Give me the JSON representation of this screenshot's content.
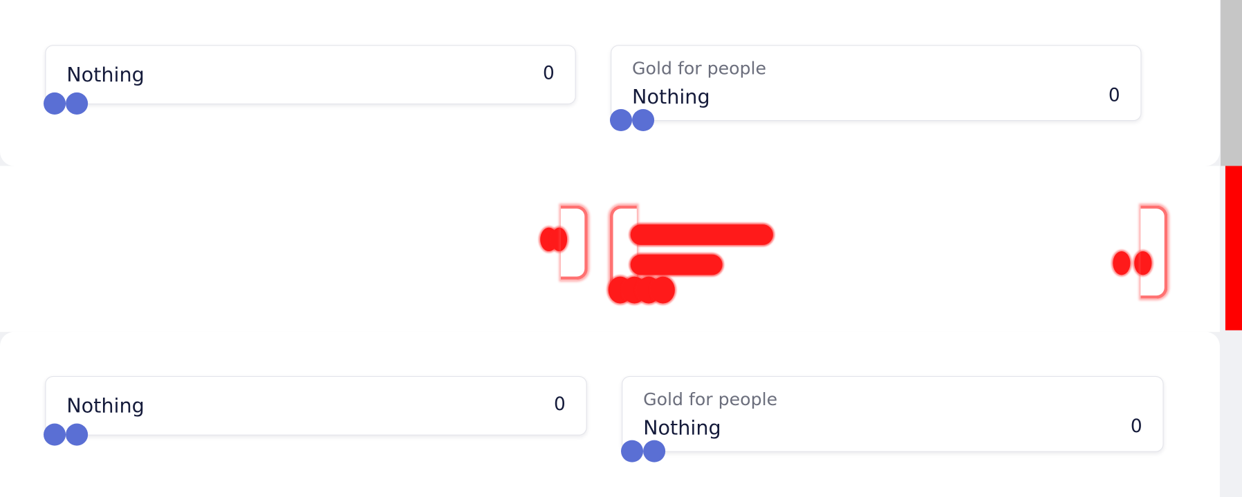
{
  "top": {
    "card_left": {
      "main_label": "Nothing",
      "value": "0"
    },
    "card_right": {
      "sub_label": "Gold for people",
      "main_label": "Nothing",
      "value": "0"
    }
  },
  "bottom": {
    "card_left": {
      "main_label": "Nothing",
      "value": "0"
    },
    "card_right": {
      "sub_label": "Gold for people",
      "main_label": "Nothing",
      "value": "0"
    }
  },
  "colors": {
    "dot": "#5a6fd4",
    "text": "#141a3a",
    "sublabel": "#6b6e7c",
    "glitch": "#ff1a1a",
    "scrollbar": "#c6c6c6"
  },
  "icons": {
    "handle": "circle-handle-icon"
  }
}
